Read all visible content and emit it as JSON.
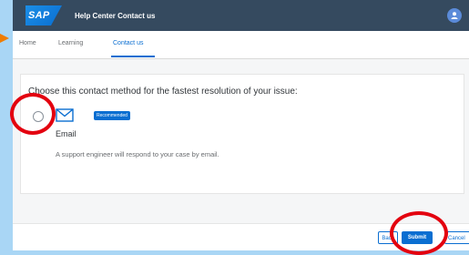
{
  "header": {
    "logo_text": "SAP",
    "title": "Help Center Contact us",
    "avatar_icon": "user-icon"
  },
  "tabs": [
    {
      "label": "Home",
      "active": false
    },
    {
      "label": "Learning",
      "active": false
    },
    {
      "label": "Contact us",
      "active": true
    }
  ],
  "contact": {
    "instruction": "Choose this contact method for the fastest resolution of your issue:",
    "method": {
      "label": "Email",
      "badge": "Recommended",
      "description": "A support engineer will respond to your case by email.",
      "icon": "envelope-icon",
      "selected": false
    }
  },
  "footer": {
    "back_label": "Back",
    "submit_label": "Submit",
    "cancel_label": "Cancel"
  },
  "colors": {
    "shell": "#354a5f",
    "accent": "#0a6ed1",
    "annotation": "#e3000f",
    "backdrop": "#a9d6f5"
  }
}
